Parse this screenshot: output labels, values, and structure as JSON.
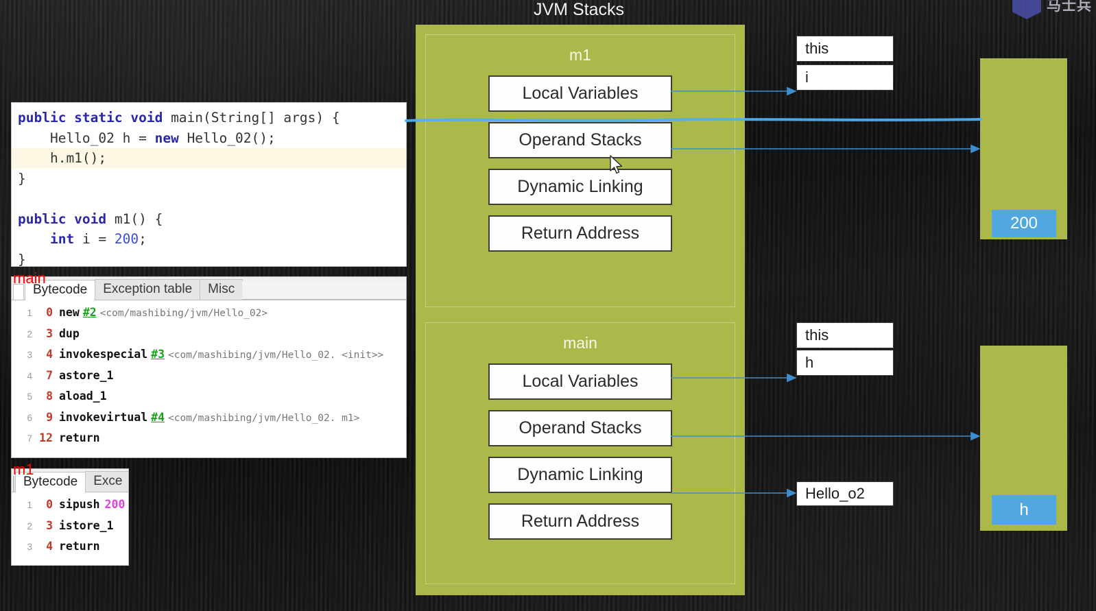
{
  "watermark": {
    "text": "马士兵"
  },
  "jvm": {
    "title": "JVM Stacks",
    "frames": [
      {
        "name": "m1",
        "slots": [
          "Local Variables",
          "Operand Stacks",
          "Dynamic Linking",
          "Return Address"
        ]
      },
      {
        "name": "main",
        "slots": [
          "Local Variables",
          "Operand Stacks",
          "Dynamic Linking",
          "Return Address"
        ]
      }
    ]
  },
  "locals": {
    "m1": [
      "this",
      "i"
    ],
    "main": [
      "this",
      "h"
    ],
    "main_dynamic_link": "Hello_o2"
  },
  "heap": {
    "m1_value": "200",
    "main_value": "h"
  },
  "code": {
    "lines": [
      {
        "highlight": false,
        "tokens": [
          {
            "t": "kw",
            "v": "public static void "
          },
          {
            "t": "pl",
            "v": "main(String[] args) {"
          }
        ]
      },
      {
        "highlight": false,
        "tokens": [
          {
            "t": "pl",
            "v": "    Hello_02 h = "
          },
          {
            "t": "kw",
            "v": "new "
          },
          {
            "t": "pl",
            "v": "Hello_02();"
          }
        ]
      },
      {
        "highlight": true,
        "tokens": [
          {
            "t": "pl",
            "v": "    h.m1();"
          }
        ]
      },
      {
        "highlight": false,
        "tokens": [
          {
            "t": "pl",
            "v": "}"
          }
        ]
      },
      {
        "highlight": false,
        "tokens": [
          {
            "t": "pl",
            "v": " "
          }
        ]
      },
      {
        "highlight": false,
        "tokens": [
          {
            "t": "kw",
            "v": "public void "
          },
          {
            "t": "pl",
            "v": "m1() {"
          }
        ]
      },
      {
        "highlight": false,
        "tokens": [
          {
            "t": "pl",
            "v": "    "
          },
          {
            "t": "kw",
            "v": "int "
          },
          {
            "t": "pl",
            "v": "i = "
          },
          {
            "t": "num",
            "v": "200"
          },
          {
            "t": "pl",
            "v": ";"
          }
        ]
      },
      {
        "highlight": false,
        "tokens": [
          {
            "t": "pl",
            "v": "}"
          }
        ]
      }
    ]
  },
  "bytecode_main": {
    "tag": "main",
    "tabs": [
      {
        "label": "Bytecode",
        "active": true
      },
      {
        "label": "Exception table",
        "active": false
      },
      {
        "label": "Misc",
        "active": false
      }
    ],
    "rows": [
      {
        "line": "1",
        "offset": "0",
        "op": "new",
        "ref": "#2",
        "desc": "<com/mashibing/jvm/Hello_02>"
      },
      {
        "line": "2",
        "offset": "3",
        "op": "dup",
        "ref": "",
        "desc": ""
      },
      {
        "line": "3",
        "offset": "4",
        "op": "invokespecial",
        "ref": "#3",
        "desc": "<com/mashibing/jvm/Hello_02. <init>>"
      },
      {
        "line": "4",
        "offset": "7",
        "op": "astore_1",
        "ref": "",
        "desc": ""
      },
      {
        "line": "5",
        "offset": "8",
        "op": "aload_1",
        "ref": "",
        "desc": ""
      },
      {
        "line": "6",
        "offset": "9",
        "op": "invokevirtual",
        "ref": "#4",
        "desc": "<com/mashibing/jvm/Hello_02. m1>"
      },
      {
        "line": "7",
        "offset": "12",
        "op": "return",
        "ref": "",
        "desc": ""
      }
    ]
  },
  "bytecode_m1": {
    "tag": "m1",
    "tabs": [
      {
        "label": "Bytecode",
        "active": true
      },
      {
        "label": "Exce",
        "active": false
      }
    ],
    "rows": [
      {
        "line": "1",
        "offset": "0",
        "op": "sipush",
        "num": "200"
      },
      {
        "line": "2",
        "offset": "3",
        "op": "istore_1",
        "num": ""
      },
      {
        "line": "3",
        "offset": "4",
        "op": "return",
        "num": ""
      }
    ]
  },
  "colors": {
    "stack_green": "#adb84b",
    "value_blue": "#51a8e0",
    "annotation_blue": "#4aa8e8",
    "tag_red": "#ff0000",
    "code_keyword": "#2a27a8"
  }
}
